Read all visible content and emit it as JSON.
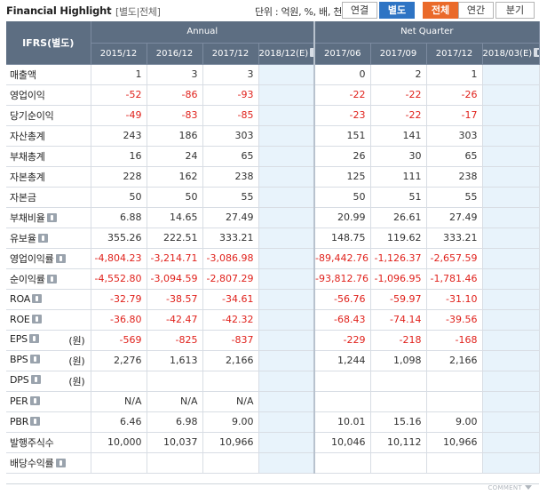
{
  "header": {
    "title": "Financial Highlight",
    "subtitle": "[별도|전체]",
    "unit": "단위 : 억원, %, 배, 천주"
  },
  "buttons": {
    "consolidated": "연결",
    "separate": "별도",
    "all": "전체",
    "annual": "연간",
    "quarter": "분기"
  },
  "table": {
    "ifrs_label": "IFRS(별도)",
    "annual_label": "Annual",
    "quarter_label": "Net Quarter",
    "annual_cols": [
      "2015/12",
      "2016/12",
      "2017/12",
      "2018/12(E)"
    ],
    "quarter_cols": [
      "2017/06",
      "2017/09",
      "2017/12",
      "2018/03(E)"
    ],
    "rows": [
      {
        "label": "매출액",
        "unit": "",
        "info": false,
        "values": [
          "1",
          "3",
          "3",
          "",
          "0",
          "2",
          "1",
          ""
        ]
      },
      {
        "label": "영업이익",
        "unit": "",
        "info": false,
        "values": [
          "-52",
          "-86",
          "-93",
          "",
          "-22",
          "-22",
          "-26",
          ""
        ]
      },
      {
        "label": "당기순이익",
        "unit": "",
        "info": false,
        "values": [
          "-49",
          "-83",
          "-85",
          "",
          "-23",
          "-22",
          "-17",
          ""
        ]
      },
      {
        "label": "자산총계",
        "unit": "",
        "info": false,
        "values": [
          "243",
          "186",
          "303",
          "",
          "151",
          "141",
          "303",
          ""
        ]
      },
      {
        "label": "부채총계",
        "unit": "",
        "info": false,
        "values": [
          "16",
          "24",
          "65",
          "",
          "26",
          "30",
          "65",
          ""
        ]
      },
      {
        "label": "자본총계",
        "unit": "",
        "info": false,
        "values": [
          "228",
          "162",
          "238",
          "",
          "125",
          "111",
          "238",
          ""
        ]
      },
      {
        "label": "자본금",
        "unit": "",
        "info": false,
        "values": [
          "50",
          "50",
          "55",
          "",
          "50",
          "51",
          "55",
          ""
        ]
      },
      {
        "label": "부채비율",
        "unit": "",
        "info": true,
        "values": [
          "6.88",
          "14.65",
          "27.49",
          "",
          "20.99",
          "26.61",
          "27.49",
          ""
        ]
      },
      {
        "label": "유보율",
        "unit": "",
        "info": true,
        "values": [
          "355.26",
          "222.51",
          "333.21",
          "",
          "148.75",
          "119.62",
          "333.21",
          ""
        ]
      },
      {
        "label": "영업이익률",
        "unit": "",
        "info": true,
        "values": [
          "-4,804.23",
          "-3,214.71",
          "-3,086.98",
          "",
          "-89,442.76",
          "-1,126.37",
          "-2,657.59",
          ""
        ]
      },
      {
        "label": "순이익률",
        "unit": "",
        "info": true,
        "values": [
          "-4,552.80",
          "-3,094.59",
          "-2,807.29",
          "",
          "-93,812.76",
          "-1,096.95",
          "-1,781.46",
          ""
        ]
      },
      {
        "label": "ROA",
        "unit": "",
        "info": true,
        "values": [
          "-32.79",
          "-38.57",
          "-34.61",
          "",
          "-56.76",
          "-59.97",
          "-31.10",
          ""
        ]
      },
      {
        "label": "ROE",
        "unit": "",
        "info": true,
        "values": [
          "-36.80",
          "-42.47",
          "-42.32",
          "",
          "-68.43",
          "-74.14",
          "-39.56",
          ""
        ]
      },
      {
        "label": "EPS",
        "unit": "(원)",
        "info": true,
        "values": [
          "-569",
          "-825",
          "-837",
          "",
          "-229",
          "-218",
          "-168",
          ""
        ]
      },
      {
        "label": "BPS",
        "unit": "(원)",
        "info": true,
        "values": [
          "2,276",
          "1,613",
          "2,166",
          "",
          "1,244",
          "1,098",
          "2,166",
          ""
        ]
      },
      {
        "label": "DPS",
        "unit": "(원)",
        "info": true,
        "values": [
          "",
          "",
          "",
          "",
          "",
          "",
          "",
          ""
        ]
      },
      {
        "label": "PER",
        "unit": "",
        "info": true,
        "values": [
          "N/A",
          "N/A",
          "N/A",
          "",
          "",
          "",
          "",
          ""
        ]
      },
      {
        "label": "PBR",
        "unit": "",
        "info": true,
        "values": [
          "6.46",
          "6.98",
          "9.00",
          "",
          "10.01",
          "15.16",
          "9.00",
          ""
        ]
      },
      {
        "label": "발행주식수",
        "unit": "",
        "info": false,
        "values": [
          "10,000",
          "10,037",
          "10,966",
          "",
          "10,046",
          "10,112",
          "10,966",
          ""
        ]
      },
      {
        "label": "배당수익률",
        "unit": "",
        "info": true,
        "values": [
          "",
          "",
          "",
          "",
          "",
          "",
          "",
          ""
        ]
      }
    ]
  },
  "footer": {
    "comment": "COMMENT"
  },
  "colors": {
    "header_bg": "#5d6e82",
    "negative": "#e0221c",
    "estimate_bg": "#e8f3fb",
    "selected_blue": "#2e74c4",
    "selected_orange": "#ea6a2a"
  }
}
